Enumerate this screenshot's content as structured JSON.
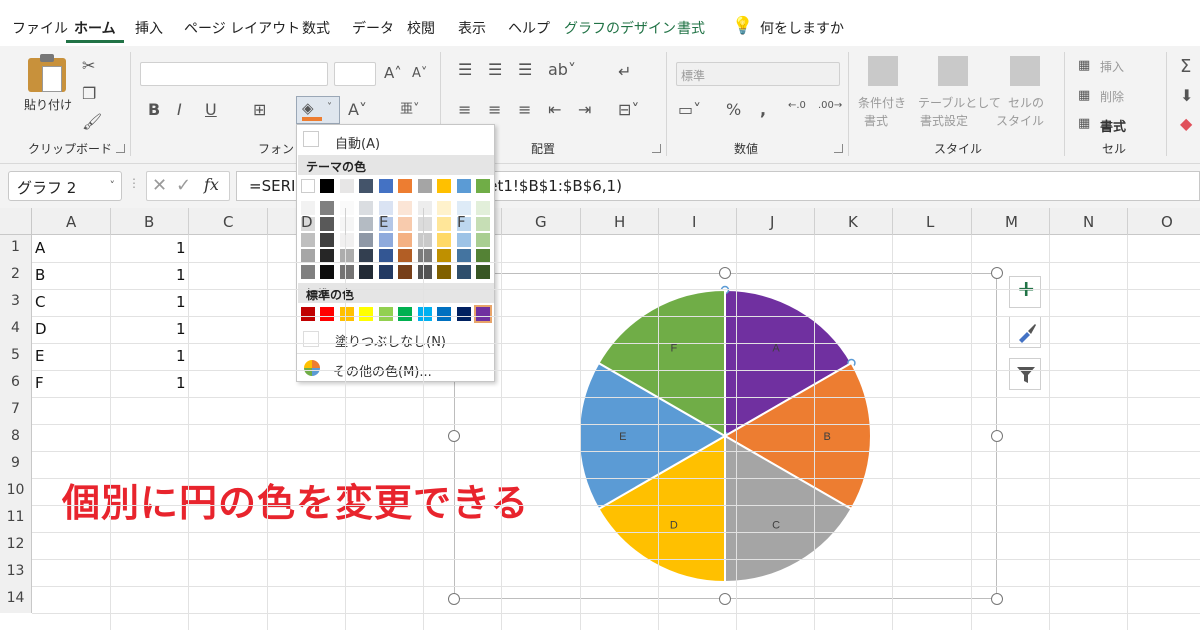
{
  "ribbon_tabs": [
    {
      "label": "ファイル"
    },
    {
      "label": "ホーム"
    },
    {
      "label": "挿入"
    },
    {
      "label": "ページ レイアウト"
    },
    {
      "label": "数式"
    },
    {
      "label": "データ"
    },
    {
      "label": "校閲"
    },
    {
      "label": "表示"
    },
    {
      "label": "ヘルプ"
    },
    {
      "label": "グラフのデザイン"
    },
    {
      "label": "書式"
    }
  ],
  "tell_me": "何をしますか",
  "ribbon": {
    "clipboard": {
      "paste": "貼り付け",
      "group": "クリップボード"
    },
    "font": {
      "group": "フォント",
      "bold": "B",
      "italic": "I",
      "underline": "U"
    },
    "alignment": {
      "group": "配置"
    },
    "number": {
      "group": "数値",
      "format": "標準",
      "percent": "%",
      "comma": ","
    },
    "styles": {
      "group": "スタイル",
      "conditional": [
        "条件付き",
        "書式"
      ],
      "table": [
        "テーブルとして",
        "書式設定"
      ],
      "cell_style": [
        "セルの",
        "スタイル"
      ]
    },
    "cells": {
      "group": "セル",
      "insert": "挿入",
      "delete": "削除",
      "format": "書式"
    }
  },
  "formula_bar": {
    "name_box": "グラフ 2",
    "formula": "=SERIES(,Sheet1!$A$1:$A$6,Sheet1!$B$1:$B$6,1)",
    "formula_left": "=SERI",
    "formula_right": "eet1!$B$1:$B$6,1)",
    "fx": "fx"
  },
  "columns": [
    "A",
    "B",
    "C",
    "D",
    "E",
    "F",
    "G",
    "H",
    "I",
    "J",
    "K",
    "L",
    "M",
    "N",
    "O"
  ],
  "rows": [
    "1",
    "2",
    "3",
    "4",
    "5",
    "6",
    "7",
    "8",
    "9",
    "10",
    "11",
    "12",
    "13",
    "14"
  ],
  "cells": [
    {
      "a": "A",
      "b": "1"
    },
    {
      "a": "B",
      "b": "1"
    },
    {
      "a": "C",
      "b": "1"
    },
    {
      "a": "D",
      "b": "1"
    },
    {
      "a": "E",
      "b": "1"
    },
    {
      "a": "F",
      "b": "1"
    }
  ],
  "color_menu": {
    "auto": "自動(A)",
    "theme_header": "テーマの色",
    "standard_header": "標準の色",
    "no_fill": "塗りつぶしなし(N)",
    "more": "その他の色(M)...",
    "theme_colors": [
      "#ffffff",
      "#000000",
      "#e7e6e6",
      "#44546a",
      "#4472c4",
      "#ed7d31",
      "#a5a5a5",
      "#ffc000",
      "#5b9bd5",
      "#70ad47"
    ],
    "standard_colors": [
      "#c00000",
      "#ff0000",
      "#ffc000",
      "#ffff00",
      "#92d050",
      "#00b050",
      "#00b0f0",
      "#0070c0",
      "#002060",
      "#7030a0"
    ]
  },
  "annotation": "個別に円の色を変更できる",
  "chart_data": {
    "type": "pie",
    "categories": [
      "A",
      "B",
      "C",
      "D",
      "E",
      "F"
    ],
    "values": [
      1,
      1,
      1,
      1,
      1,
      1
    ],
    "colors": [
      "#7030a0",
      "#ed7d31",
      "#a5a5a5",
      "#ffc000",
      "#5b9bd5",
      "#70ad47"
    ],
    "selected_slice": "A",
    "title": ""
  },
  "chart_buttons": {
    "add": "+",
    "style": "brush",
    "filter": "filter"
  }
}
